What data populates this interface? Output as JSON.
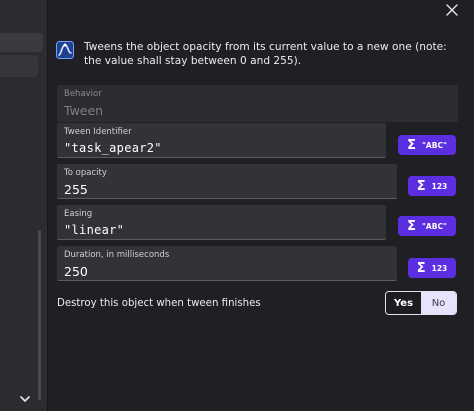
{
  "description": "Tweens the object opacity from its current value to a new one (note: the value shall stay between 0 and 255).",
  "fields": {
    "behavior": {
      "label": "Behavior",
      "value": "Tween"
    },
    "tween_identifier": {
      "label": "Tween Identifier",
      "value": "\"task_apear2\""
    },
    "to_opacity": {
      "label": "To opacity",
      "value": "255"
    },
    "easing": {
      "label": "Easing",
      "value": "\"linear\""
    },
    "duration": {
      "label": "Duration, in milliseconds",
      "value": "250"
    }
  },
  "expression_buttons": {
    "text_label": "\"ABC\"",
    "number_label": "123",
    "sigma": "Σ"
  },
  "destroy_toggle": {
    "label": "Destroy this object when tween finishes",
    "yes": "Yes",
    "no": "No",
    "selected": "Yes"
  },
  "colors": {
    "accent": "#5b2ee0",
    "background": "#202024",
    "field_bg": "#323238"
  },
  "icons": [
    "close-icon",
    "tween-opacity-icon",
    "chevron-down-icon",
    "sigma-icon"
  ]
}
